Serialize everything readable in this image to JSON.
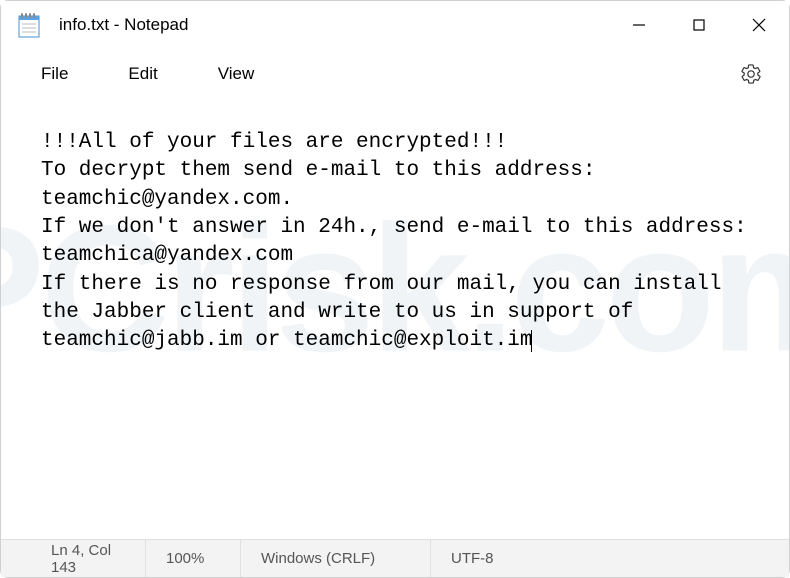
{
  "titlebar": {
    "title": "info.txt - Notepad"
  },
  "menubar": {
    "file": "File",
    "edit": "Edit",
    "view": "View"
  },
  "content": {
    "text": "!!!All of your files are encrypted!!!\nTo decrypt them send e-mail to this address: teamchic@yandex.com.\nIf we don't answer in 24h., send e-mail to this address: teamchica@yandex.com\nIf there is no response from our mail, you can install the Jabber client and write to us in support of teamchic@jabb.im or teamchic@exploit.im"
  },
  "statusbar": {
    "position": "Ln 4, Col 143",
    "zoom": "100%",
    "line_ending": "Windows (CRLF)",
    "encoding": "UTF-8"
  },
  "icons": {
    "notepad": "notepad-icon",
    "minimize": "minimize-icon",
    "maximize": "maximize-icon",
    "close": "close-icon",
    "settings": "gear-icon"
  }
}
